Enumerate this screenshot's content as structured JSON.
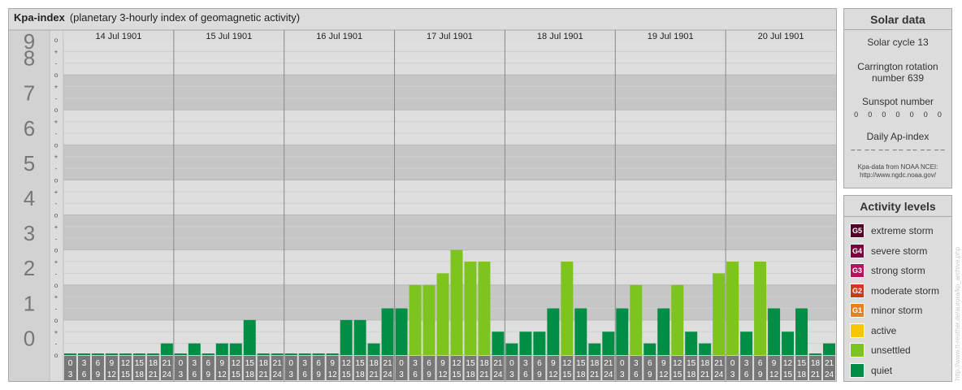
{
  "title": {
    "main": "Kpa-index",
    "sub": "(planetary 3-hourly index of geomagnetic activity)"
  },
  "colors": {
    "quiet": "#008e44",
    "unsettled": "#7dc41f",
    "active": "#f9c700",
    "g1": "#e7811d",
    "g2": "#cc3a1d",
    "g3": "#b2135f",
    "g4": "#73073e",
    "g5": "#520027",
    "band_dark": "#c6c6c6",
    "band_light": "#dedede",
    "xlabel_bg": "#777777"
  },
  "chart_data": {
    "type": "bar",
    "ylim": [
      0,
      9
    ],
    "y_ticks": [
      "0",
      "1",
      "2",
      "3",
      "4",
      "5",
      "6",
      "7",
      "8",
      "9"
    ],
    "sub_ticks": [
      "o",
      "-",
      "+"
    ],
    "days": [
      "14 Jul 1901",
      "15 Jul 1901",
      "16 Jul 1901",
      "17 Jul 1901",
      "18 Jul 1901",
      "19 Jul 1901",
      "20 Jul 1901"
    ],
    "hour_labels": [
      [
        "0",
        "3"
      ],
      [
        "3",
        "6"
      ],
      [
        "6",
        "9"
      ],
      [
        "9",
        "12"
      ],
      [
        "12",
        "15"
      ],
      [
        "15",
        "18"
      ],
      [
        "18",
        "21"
      ],
      [
        "21",
        "24"
      ]
    ],
    "values": [
      0,
      0,
      0,
      0,
      0,
      0,
      0,
      0.333,
      0,
      0.333,
      0,
      0.333,
      0.333,
      1,
      0,
      0,
      0,
      0,
      0,
      0,
      1,
      1,
      0.333,
      1.333,
      1.333,
      2,
      2,
      2.333,
      3,
      2.667,
      2.667,
      0.667,
      0.333,
      0.667,
      0.667,
      1.333,
      2.667,
      1.333,
      0.333,
      0.667,
      1.333,
      2,
      0.333,
      1.333,
      2,
      0.667,
      0.333,
      2.333,
      2.667,
      0.667,
      2.667,
      1.333,
      0.667,
      1.333,
      0,
      0.333
    ]
  },
  "solar": {
    "title": "Solar data",
    "cycle": "Solar cycle 13",
    "carrington_line1": "Carrington rotation",
    "carrington_line2": "number 639",
    "sunspot_label": "Sunspot number",
    "sunspot_values": [
      "0",
      "0",
      "0",
      "0",
      "0",
      "0",
      "0"
    ],
    "ap_label": "Daily Ap-index",
    "ap_values": [
      "– –",
      "– –",
      "– –",
      "– –",
      "– –",
      "– –",
      "– –"
    ],
    "source_line1": "Kpa-data from NOAA NCEI:",
    "source_line2": "http://www.ngdc.noaa.gov/"
  },
  "activity": {
    "title": "Activity levels",
    "levels": [
      {
        "code": "G5",
        "label": "extreme storm",
        "color": "#520027"
      },
      {
        "code": "G4",
        "label": "severe storm",
        "color": "#73073e"
      },
      {
        "code": "G3",
        "label": "strong storm",
        "color": "#b2135f"
      },
      {
        "code": "G2",
        "label": "moderate storm",
        "color": "#cc3a1d"
      },
      {
        "code": "G1",
        "label": "minor storm",
        "color": "#e7811d"
      },
      {
        "code": "",
        "label": "active",
        "color": "#f9c700"
      },
      {
        "code": "",
        "label": "unsettled",
        "color": "#7dc41f"
      },
      {
        "code": "",
        "label": "quiet",
        "color": "#008e44"
      }
    ]
  },
  "watermark": "http://www.tt-reuther.de/aurora/kp_archive.php"
}
